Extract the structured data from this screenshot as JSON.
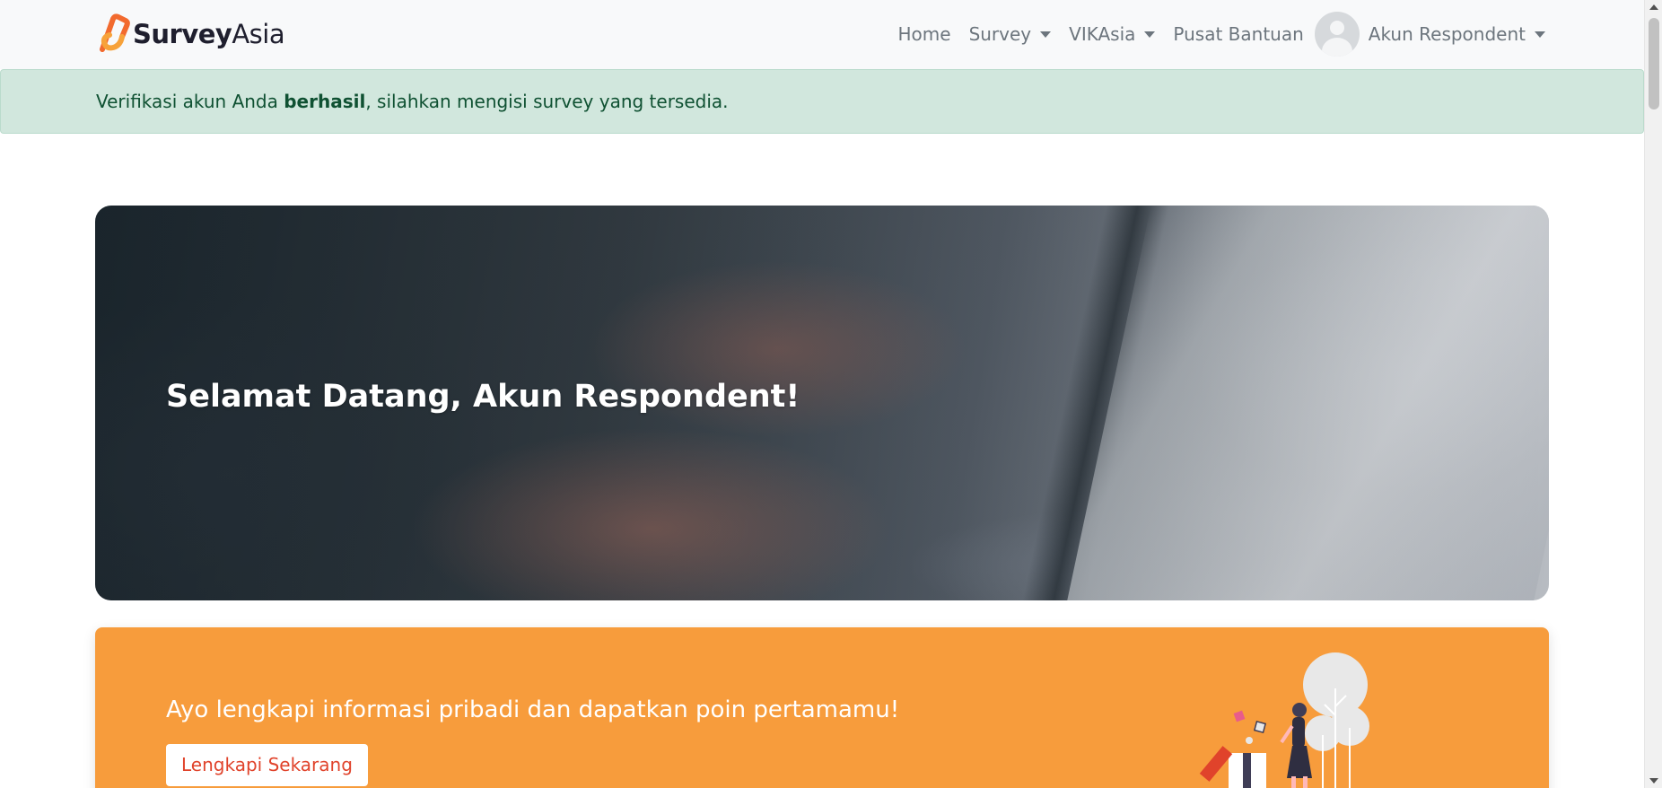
{
  "brand": {
    "name_bold": "Survey",
    "name_light": "Asia",
    "logo_color": "#f26a2e"
  },
  "nav": {
    "home": "Home",
    "survey": "Survey",
    "vikasia": "VIKAsia",
    "help": "Pusat Bantuan",
    "account": "Akun Respondent"
  },
  "alert": {
    "prefix": "Verifikasi akun Anda ",
    "bold": "berhasil",
    "suffix": ", silahkan mengisi survey yang tersedia.",
    "color": "#d1e7dd"
  },
  "hero": {
    "title": "Selamat Datang, Akun Respondent!"
  },
  "promo": {
    "text": "Ayo lengkapi informasi pribadi dan dapatkan poin pertamamu!",
    "button": "Lengkapi Sekarang",
    "color": "#f79c3c"
  },
  "icons": [
    "surveyasia-logo-icon",
    "avatar-icon",
    "chevron-down-icon",
    "gift-illustration-icon"
  ]
}
